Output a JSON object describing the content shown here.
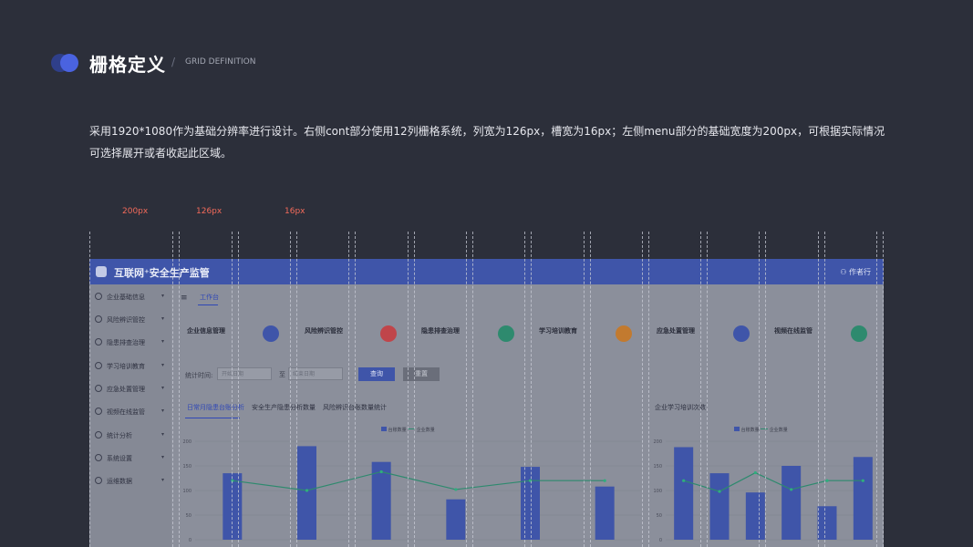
{
  "header": {
    "title": "栅格定义",
    "slash": "/",
    "subtitle": "GRID DEFINITION"
  },
  "description": {
    "line1": "采用1920*1080作为基础分辨率进行设计。右侧cont部分使用12列栅格系统，列宽为126px，槽宽为16px；左侧menu部分的基础宽度为200px，可根据实际情况",
    "line2": "可选择展开或者收起此区域。"
  },
  "dimensions": {
    "menu": "200px",
    "column": "126px",
    "gutter": "16px"
  },
  "app": {
    "title": "互联网⁺安全生产监管",
    "user": "作者行",
    "menu_icon": "≡",
    "active_tab": "工作台",
    "sidebar": [
      {
        "label": "企业基础信息"
      },
      {
        "label": "风险辨识管控"
      },
      {
        "label": "隐患排查治理"
      },
      {
        "label": "学习培训教育"
      },
      {
        "label": "应急处置管理"
      },
      {
        "label": "视频在线监管"
      },
      {
        "label": "统计分析"
      },
      {
        "label": "系统设置"
      },
      {
        "label": "运维数据"
      }
    ],
    "cards": [
      {
        "label": "企业信息管理",
        "color": "#3f55a9"
      },
      {
        "label": "风险辨识管控",
        "color": "#c0454a"
      },
      {
        "label": "隐患排查治理",
        "color": "#2e8a6e"
      },
      {
        "label": "学习培训教育",
        "color": "#c27a2f"
      },
      {
        "label": "应急处置管理",
        "color": "#3f55a9"
      },
      {
        "label": "视频在线监管",
        "color": "#2e8a6e"
      }
    ],
    "filter": {
      "label": "统计时间:",
      "start_placeholder": "开始日期",
      "separator": "至",
      "end_placeholder": "结束日期",
      "query": "查询",
      "reset": "重置"
    },
    "chart_tabs": [
      "日常月隐患台账分析",
      "安全生产隐患分析数量",
      "风险辨识台账数量统计"
    ],
    "right_chart_title": "企业学习培训次数",
    "legend": {
      "bar": "台账数量",
      "line": "企业数量"
    }
  },
  "chart_data": [
    {
      "type": "bar",
      "title": "日常月隐患台账分析",
      "categories": [
        "",
        "",
        "",
        "",
        "",
        ""
      ],
      "series": [
        {
          "name": "台账数量",
          "type": "bar",
          "values": [
            135,
            190,
            158,
            82,
            148,
            108
          ]
        },
        {
          "name": "企业数量",
          "type": "line",
          "values": [
            120,
            100,
            138,
            102,
            120,
            120
          ]
        }
      ],
      "yticks": [
        "0",
        "50",
        "100",
        "150",
        "200"
      ],
      "ylim": [
        0,
        200
      ],
      "colors": {
        "bar": "#3f55a9",
        "line": "#2e8a6e"
      },
      "grid": true,
      "legend": "top-center"
    },
    {
      "type": "bar",
      "title": "企业学习培训次数",
      "categories": [
        "",
        "",
        "",
        "",
        "",
        ""
      ],
      "series": [
        {
          "name": "台账数量",
          "type": "bar",
          "values": [
            188,
            135,
            96,
            150,
            68,
            168
          ]
        },
        {
          "name": "企业数量",
          "type": "line",
          "values": [
            120,
            98,
            136,
            102,
            120,
            120
          ]
        }
      ],
      "yticks": [
        "0",
        "50",
        "100",
        "150",
        "200"
      ],
      "ylim": [
        0,
        200
      ],
      "colors": {
        "bar": "#3f55a9",
        "line": "#2e8a6e"
      },
      "grid": true,
      "legend": "top-center"
    }
  ]
}
